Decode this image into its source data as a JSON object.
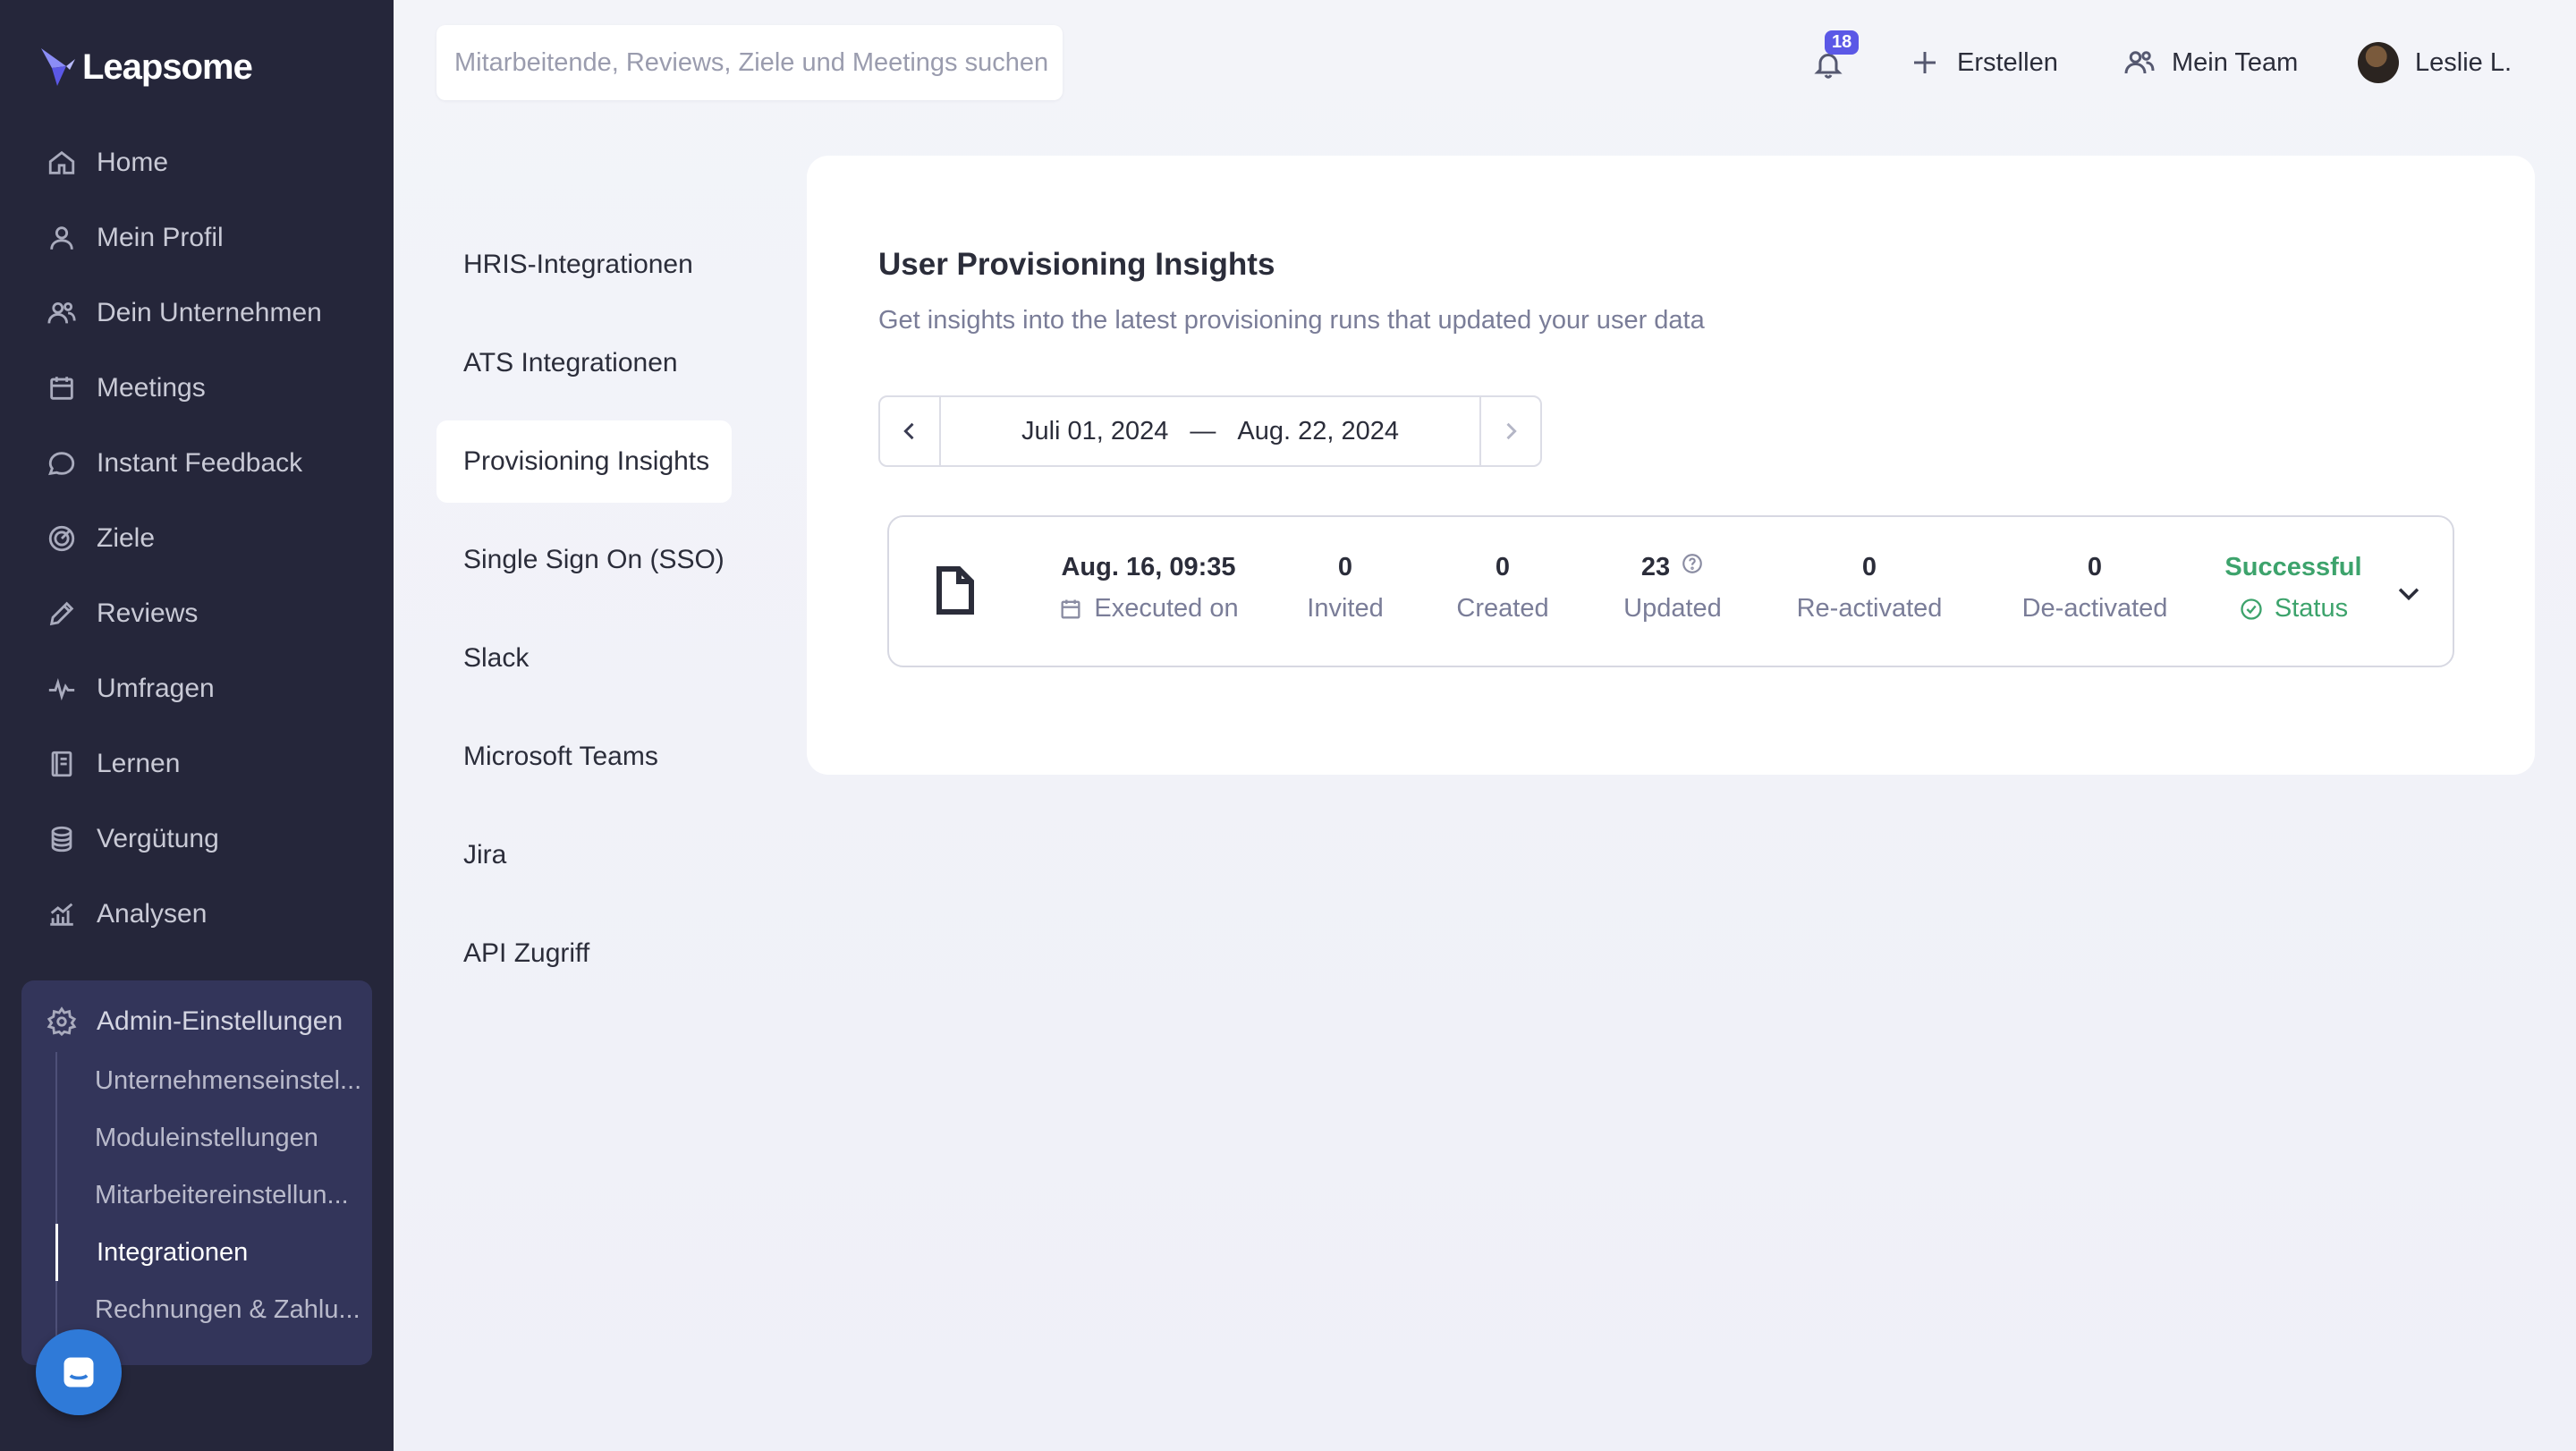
{
  "app": {
    "logo_text": "Leapsome"
  },
  "sidebar": {
    "items": [
      {
        "label": "Home",
        "icon": "home-icon"
      },
      {
        "label": "Mein Profil",
        "icon": "user-icon"
      },
      {
        "label": "Dein Unternehmen",
        "icon": "users-icon"
      },
      {
        "label": "Meetings",
        "icon": "calendar-icon"
      },
      {
        "label": "Instant Feedback",
        "icon": "chat-icon"
      },
      {
        "label": "Ziele",
        "icon": "target-icon"
      },
      {
        "label": "Reviews",
        "icon": "pencil-icon"
      },
      {
        "label": "Umfragen",
        "icon": "pulse-icon"
      },
      {
        "label": "Lernen",
        "icon": "book-icon"
      },
      {
        "label": "Vergütung",
        "icon": "coins-icon"
      },
      {
        "label": "Analysen",
        "icon": "chart-icon"
      }
    ],
    "admin": {
      "label": "Admin-Einstellungen",
      "sub_items": [
        {
          "label": "Unternehmenseinstel..."
        },
        {
          "label": "Moduleinstellungen"
        },
        {
          "label": "Mitarbeitereinstellun..."
        },
        {
          "label": "Integrationen",
          "active": true
        },
        {
          "label": "Rechnungen & Zahlu..."
        }
      ]
    }
  },
  "topbar": {
    "search_placeholder": "Mitarbeitende, Reviews, Ziele und Meetings suchen",
    "notifications_count": "18",
    "create_label": "Erstellen",
    "team_label": "Mein Team",
    "user_name": "Leslie L."
  },
  "subnav": {
    "items": [
      {
        "label": "HRIS-Integrationen"
      },
      {
        "label": "ATS Integrationen"
      },
      {
        "label": "Provisioning Insights",
        "active": true
      },
      {
        "label": "Single Sign On (SSO)"
      },
      {
        "label": "Slack"
      },
      {
        "label": "Microsoft Teams"
      },
      {
        "label": "Jira"
      },
      {
        "label": "API Zugriff"
      }
    ]
  },
  "main": {
    "title": "User Provisioning Insights",
    "subtitle": "Get insights into the latest provisioning runs that updated your user data",
    "date_range": {
      "start": "Juli 01, 2024",
      "separator": "—",
      "end": "Aug. 22, 2024"
    },
    "run": {
      "executed_on_value": "Aug. 16, 09:35",
      "executed_on_label": "Executed on",
      "invited_value": "0",
      "invited_label": "Invited",
      "created_value": "0",
      "created_label": "Created",
      "updated_value": "23",
      "updated_label": "Updated",
      "reactivated_value": "0",
      "reactivated_label": "Re-activated",
      "deactivated_value": "0",
      "deactivated_label": "De-activated",
      "status_value": "Successful",
      "status_label": "Status"
    }
  },
  "colors": {
    "sidebar_bg": "#25263a",
    "admin_bg": "#33355a",
    "accent": "#5b58e6",
    "success": "#3da36c",
    "chat_bubble": "#2f7ad8"
  }
}
